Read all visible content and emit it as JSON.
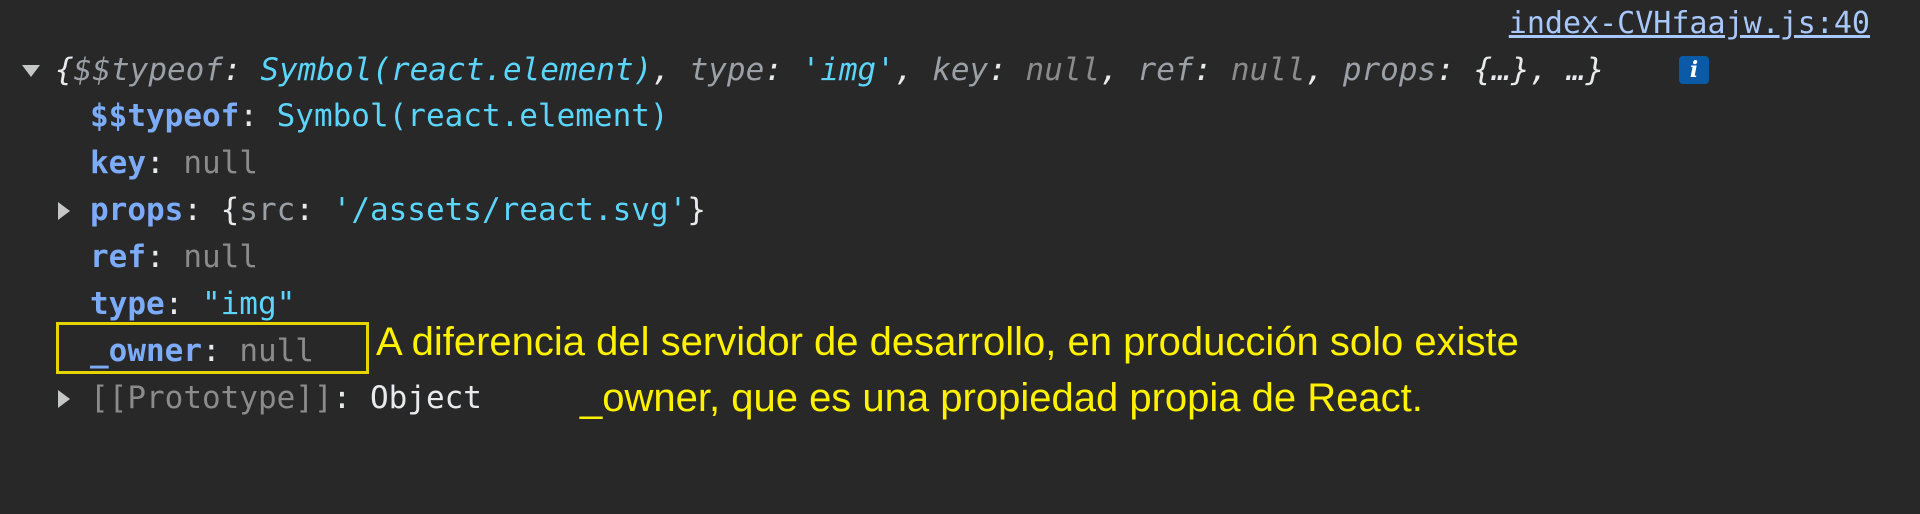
{
  "source_link": "index-CVHfaajw.js:40",
  "summary": {
    "open_brace": "{",
    "typeof_key": "$$typeof",
    "typeof_value": "Symbol(react.element)",
    "type_key": "type",
    "type_value": "'img'",
    "key_key": "key",
    "key_value": "null",
    "ref_key": "ref",
    "ref_value": "null",
    "props_key": "props",
    "props_value": "{…}",
    "ellipsis_tail": "…}",
    "info_badge": "i"
  },
  "properties": [
    {
      "key": "$$typeof",
      "value": "Symbol(react.element)",
      "expandable": false
    },
    {
      "key": "key",
      "value": "null",
      "expandable": false
    },
    {
      "key": "props",
      "value_open": "{",
      "value_inner_key": "src",
      "value_inner_val": "'/assets/react.svg'",
      "value_close": "}",
      "expandable": true
    },
    {
      "key": "ref",
      "value": "null",
      "expandable": false
    },
    {
      "key": "type",
      "value": "\"img\"",
      "expandable": false
    },
    {
      "key": "_owner",
      "value": "null",
      "expandable": false
    },
    {
      "key": "[[Prototype]]",
      "value": "Object",
      "expandable": true
    }
  ],
  "annotation": {
    "line1": "A diferencia del servidor de desarrollo, en producción solo existe",
    "line2": "_owner, que es una propiedad propia de React."
  },
  "colors": {
    "background": "#282828",
    "annotation": "#fff200",
    "highlight_border": "#e6d300",
    "key_bold": "#7cacf8",
    "string": "#5cd5fb",
    "null": "#8b8b8b"
  }
}
